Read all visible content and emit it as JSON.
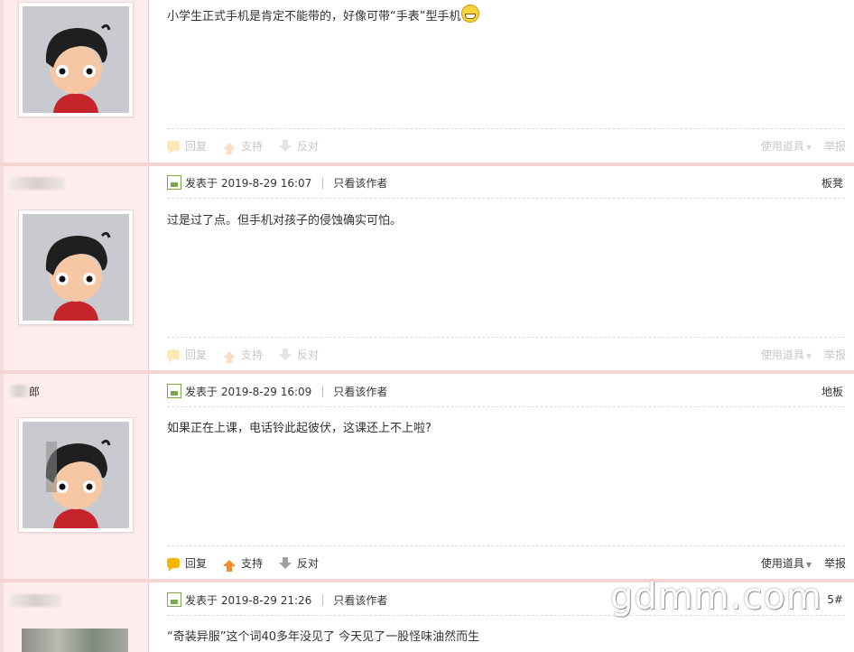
{
  "posts": [
    {
      "content": "小学生正式手机是肯定不能带的，好像可带“手表”型手机",
      "actions": {
        "reply": "回复",
        "support": "支持",
        "oppose": "反对",
        "tools": "使用道具",
        "report": "举报"
      }
    },
    {
      "meta": {
        "posted": "发表于 2019-8-29 16:07",
        "only_author": "只看该作者",
        "floor": "板凳"
      },
      "content": "过是过了点。但手机对孩子的侵蚀确实可怕。",
      "actions": {
        "reply": "回复",
        "support": "支持",
        "oppose": "反对",
        "tools": "使用道具",
        "report": "举报"
      }
    },
    {
      "username_fragment": "郎",
      "meta": {
        "posted": "发表于 2019-8-29 16:09",
        "only_author": "只看该作者",
        "floor": "地板"
      },
      "content": "如果正在上课，电话铃此起彼伏，这课还上不上啦?",
      "actions": {
        "reply": "回复",
        "support": "支持",
        "oppose": "反对",
        "tools": "使用道具",
        "report": "举报"
      }
    },
    {
      "meta": {
        "posted": "发表于 2019-8-29 21:26",
        "only_author": "只看该作者",
        "floor": "5#"
      },
      "content": "“奇装异服”这个词40多年没见了  今天见了一股怪味油然而生"
    }
  ],
  "watermark": "gdmm.com",
  "colors": {
    "sidebar_bg": "#ffecec",
    "separator": "#f7d4d4",
    "reply_icon": "#f5b400",
    "support_icon": "#f58a2a",
    "oppose_icon": "#9aa0a6"
  }
}
